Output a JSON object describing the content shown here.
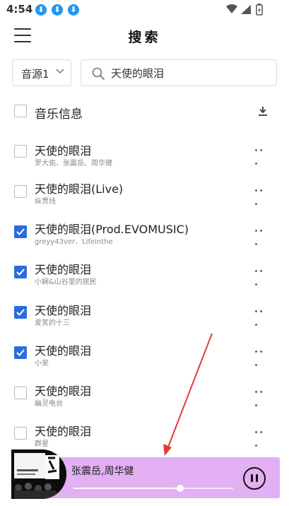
{
  "status_bar": {
    "time": "4:54",
    "download_badges": [
      "⬇",
      "⬇",
      "⬇"
    ]
  },
  "header": {
    "title": "搜索"
  },
  "search": {
    "source_label": "音源1",
    "query": "天使的眼泪"
  },
  "info_header": {
    "label": "音乐信息"
  },
  "songs": [
    {
      "title": "天使的眼泪",
      "artist": "罗大佑、张震岳、周华健",
      "checked": false
    },
    {
      "title": "天使的眼泪(Live)",
      "artist": "纵贯线",
      "checked": false
    },
    {
      "title": "天使的眼泪(Prod.EVOMUSIC)",
      "artist": "greyy43ver、Lifeinthe",
      "checked": true
    },
    {
      "title": "天使的眼泪",
      "artist": "小娴&山谷里的居民",
      "checked": true
    },
    {
      "title": "天使的眼泪",
      "artist": "爱笑的十三",
      "checked": true
    },
    {
      "title": "天使的眼泪",
      "artist": "小安",
      "checked": true
    },
    {
      "title": "天使的眼泪",
      "artist": "幽灵电台",
      "checked": false
    },
    {
      "title": "天使的眼泪",
      "artist": "群星",
      "checked": false
    }
  ],
  "player": {
    "artist": "张震岳,周华健",
    "progress": 0.67,
    "background": "#e3b0f3"
  },
  "colors": {
    "accent": "#2a6ce0",
    "annotation": "#e53935",
    "badge": "#2196f3"
  }
}
